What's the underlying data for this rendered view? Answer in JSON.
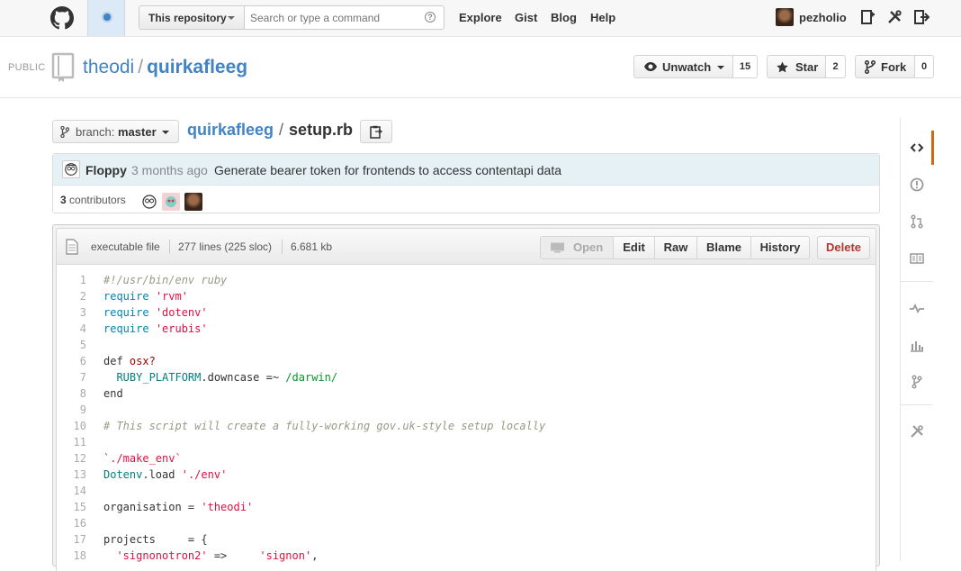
{
  "header": {
    "search_scope": "This repository",
    "search_placeholder": "Search or type a command",
    "search_help": "?",
    "nav": [
      "Explore",
      "Gist",
      "Blog",
      "Help"
    ],
    "username": "pezholio"
  },
  "repo": {
    "visibility": "PUBLIC",
    "owner": "theodi",
    "separator": "/",
    "name": "quirkafleeg",
    "unwatch_label": "Unwatch",
    "watch_count": "15",
    "star_label": "Star",
    "star_count": "2",
    "fork_label": "Fork",
    "fork_count": "0"
  },
  "branch": {
    "prefix": "branch:",
    "name": "master"
  },
  "breadcrumb": {
    "repo": "quirkafleeg",
    "separator": "/",
    "file": "setup.rb"
  },
  "commit": {
    "author": "Floppy",
    "time": "3 months ago",
    "message": "Generate bearer token for frontends to access contentapi data",
    "contributors_count": "3",
    "contributors_label": "contributors"
  },
  "file": {
    "mode": "executable file",
    "lines": "277 lines (225 sloc)",
    "size": "6.681 kb",
    "buttons": [
      "Open",
      "Edit",
      "Raw",
      "Blame",
      "History"
    ],
    "delete_label": "Delete"
  },
  "code_lines": [
    {
      "n": "1",
      "tokens": [
        [
          "c-comment",
          "#!/usr/bin/env ruby"
        ]
      ]
    },
    {
      "n": "2",
      "tokens": [
        [
          "c-keyword",
          "require"
        ],
        [
          "c-plain",
          " "
        ],
        [
          "c-string",
          "'rvm'"
        ]
      ]
    },
    {
      "n": "3",
      "tokens": [
        [
          "c-keyword",
          "require"
        ],
        [
          "c-plain",
          " "
        ],
        [
          "c-string",
          "'dotenv'"
        ]
      ]
    },
    {
      "n": "4",
      "tokens": [
        [
          "c-keyword",
          "require"
        ],
        [
          "c-plain",
          " "
        ],
        [
          "c-string",
          "'erubis'"
        ]
      ]
    },
    {
      "n": "5",
      "tokens": []
    },
    {
      "n": "6",
      "tokens": [
        [
          "c-def",
          "def"
        ],
        [
          "c-plain",
          " "
        ],
        [
          "c-method",
          "osx?"
        ]
      ]
    },
    {
      "n": "7",
      "tokens": [
        [
          "c-plain",
          "  "
        ],
        [
          "c-const",
          "RUBY_PLATFORM"
        ],
        [
          "c-plain",
          ".downcase =~ "
        ],
        [
          "c-regex",
          "/darwin/"
        ]
      ]
    },
    {
      "n": "8",
      "tokens": [
        [
          "c-def",
          "end"
        ]
      ]
    },
    {
      "n": "9",
      "tokens": []
    },
    {
      "n": "10",
      "tokens": [
        [
          "c-comment",
          "# This script will create a fully-working gov.uk-style setup locally"
        ]
      ]
    },
    {
      "n": "11",
      "tokens": []
    },
    {
      "n": "12",
      "tokens": [
        [
          "c-string",
          "`./make_env`"
        ]
      ]
    },
    {
      "n": "13",
      "tokens": [
        [
          "c-const",
          "Dotenv"
        ],
        [
          "c-plain",
          ".load "
        ],
        [
          "c-string",
          "'./env'"
        ]
      ]
    },
    {
      "n": "14",
      "tokens": []
    },
    {
      "n": "15",
      "tokens": [
        [
          "c-plain",
          "organisation = "
        ],
        [
          "c-string",
          "'theodi'"
        ]
      ]
    },
    {
      "n": "16",
      "tokens": []
    },
    {
      "n": "17",
      "tokens": [
        [
          "c-plain",
          "projects     = {"
        ]
      ]
    },
    {
      "n": "18",
      "tokens": [
        [
          "c-plain",
          "  "
        ],
        [
          "c-string",
          "'signonotron2'"
        ],
        [
          "c-plain",
          " =>     "
        ],
        [
          "c-string",
          "'signon'"
        ],
        [
          "c-plain",
          ","
        ]
      ]
    }
  ],
  "sidebar": [
    "code-icon",
    "issues-icon",
    "pull-request-icon",
    "wiki-icon",
    "pulse-icon",
    "graphs-icon",
    "network-icon",
    "settings-icon"
  ],
  "colors": {
    "link": "#4183c4",
    "active_tab": "#d26911",
    "delete": "#b33630",
    "commit_bg": "#e6f1f6"
  }
}
